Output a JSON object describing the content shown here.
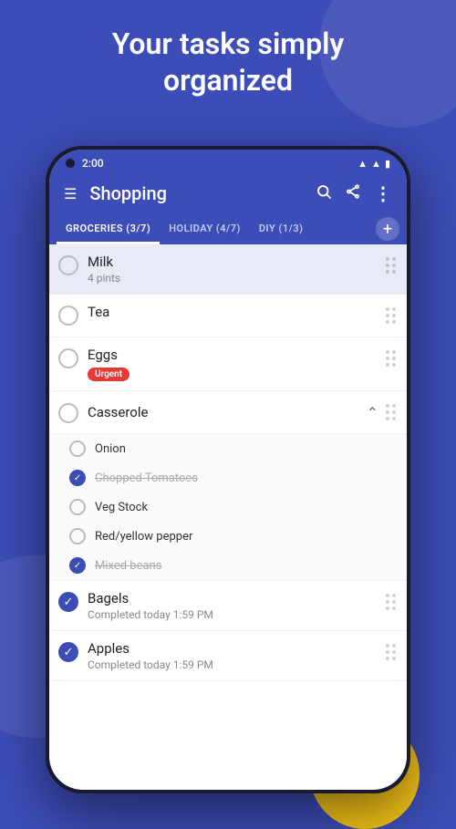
{
  "header": {
    "title_line1": "Your tasks simply",
    "title_line2": "organized"
  },
  "status_bar": {
    "time": "2:00"
  },
  "app_bar": {
    "title": "Shopping",
    "menu_icon": "☰",
    "search_icon": "🔍",
    "share_icon": "⬆",
    "more_icon": "⋮"
  },
  "tabs": [
    {
      "label": "GROCERIES (3/7)",
      "active": true
    },
    {
      "label": "HOLIDAY (4/7)",
      "active": false
    },
    {
      "label": "DIY (1/3)",
      "active": false
    }
  ],
  "tasks": [
    {
      "id": "milk",
      "title": "Milk",
      "subtitle": "4 pints",
      "checked": false,
      "highlighted": true,
      "tag": null
    },
    {
      "id": "tea",
      "title": "Tea",
      "subtitle": null,
      "checked": false,
      "highlighted": false,
      "tag": null
    },
    {
      "id": "eggs",
      "title": "Eggs",
      "subtitle": null,
      "checked": false,
      "highlighted": false,
      "tag": "Urgent"
    },
    {
      "id": "casserole",
      "title": "Casserole",
      "subtitle": null,
      "checked": false,
      "highlighted": false,
      "tag": null,
      "expanded": true,
      "sub_items": [
        {
          "label": "Onion",
          "completed": false
        },
        {
          "label": "Chopped Tomatoes",
          "completed": true
        },
        {
          "label": "Veg Stock",
          "completed": false
        },
        {
          "label": "Red/yellow pepper",
          "completed": false
        },
        {
          "label": "Mixed beans",
          "completed": true
        }
      ]
    }
  ],
  "completed_tasks": [
    {
      "id": "bagels",
      "title": "Bagels",
      "subtitle": "Completed today 1:59 PM"
    },
    {
      "id": "apples",
      "title": "Apples",
      "subtitle": "Completed today 1:59 PM"
    }
  ],
  "colors": {
    "primary": "#3d4db7",
    "urgent_red": "#e53935",
    "checked_blue": "#3d4db7"
  }
}
